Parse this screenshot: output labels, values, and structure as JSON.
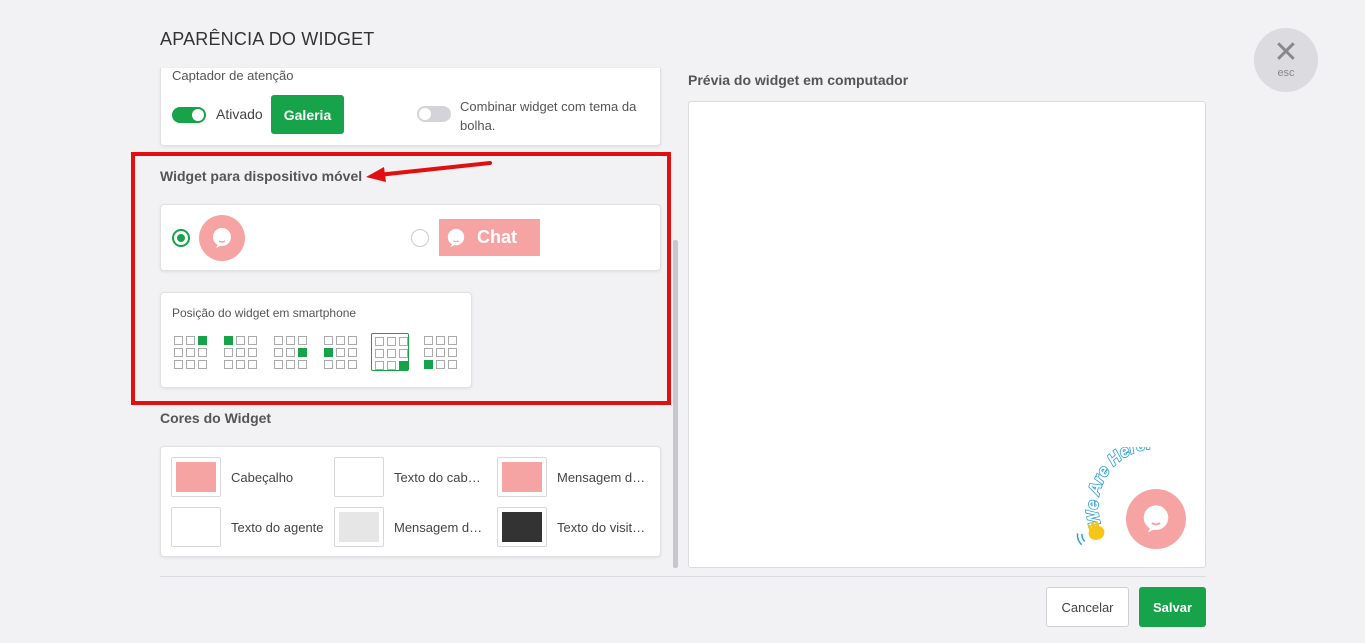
{
  "modal": {
    "title": "APARÊNCIA DO WIDGET",
    "close_label": "esc"
  },
  "attention": {
    "label": "Captador de atenção",
    "enabled_label": "Ativado",
    "enabled": true,
    "gallery_label": "Galeria",
    "combine_label": "Combinar widget com tema da bolha.",
    "combine_enabled": false
  },
  "mobile": {
    "title": "Widget para dispositivo móvel",
    "options": [
      {
        "type": "bubble",
        "selected": true
      },
      {
        "type": "button",
        "label": "Chat",
        "selected": false
      }
    ],
    "position_label": "Posição do widget em smartphone",
    "positions": [
      {
        "active": [
          2
        ],
        "selected": false
      },
      {
        "active": [
          0
        ],
        "selected": false
      },
      {
        "active": [
          5
        ],
        "selected": false
      },
      {
        "active": [
          3
        ],
        "selected": false
      },
      {
        "active": [
          8
        ],
        "selected": true
      },
      {
        "active": [
          6
        ],
        "selected": false
      }
    ]
  },
  "colors": {
    "title": "Cores do Widget",
    "items": [
      {
        "label": "Cabeçalho",
        "color": "#f6a3a3"
      },
      {
        "label": "Texto do cabeçalho",
        "color": "#ffffff"
      },
      {
        "label": "Mensagem do agente",
        "color": "#f6a3a3"
      },
      {
        "label": "Texto do agente",
        "color": "#ffffff"
      },
      {
        "label": "Mensagem do visitante",
        "color": "#e6e6e6"
      },
      {
        "label": "Texto do visitante",
        "color": "#333333"
      }
    ]
  },
  "preview": {
    "title": "Prévia do widget em computador",
    "badge_text": "We Are Here!"
  },
  "footer": {
    "cancel_label": "Cancelar",
    "save_label": "Salvar"
  },
  "theme": {
    "accent": "#16a34a",
    "bubble": "#f6a3a3",
    "highlight": "#e01010"
  }
}
